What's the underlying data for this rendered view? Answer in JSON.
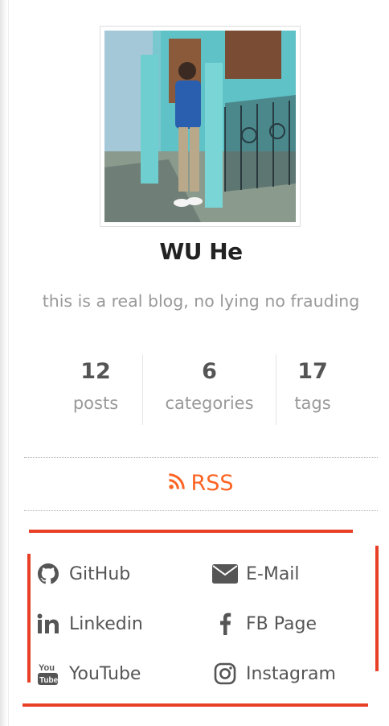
{
  "author": {
    "name": "WU He",
    "description": "this is a real blog, no lying no frauding"
  },
  "stats": [
    {
      "count": "12",
      "label": "posts"
    },
    {
      "count": "6",
      "label": "categories"
    },
    {
      "count": "17",
      "label": "tags"
    }
  ],
  "rss": {
    "label": "RSS",
    "icon": "rss-icon"
  },
  "social_links": [
    {
      "label": "GitHub",
      "icon": "github-icon"
    },
    {
      "label": "E-Mail",
      "icon": "envelope-icon"
    },
    {
      "label": "Linkedin",
      "icon": "linkedin-icon"
    },
    {
      "label": "FB Page",
      "icon": "facebook-icon"
    },
    {
      "label": "YouTube",
      "icon": "youtube-icon"
    },
    {
      "label": "Instagram",
      "icon": "instagram-icon"
    }
  ],
  "colors": {
    "accent_orange": "#fc6423",
    "annotation_red": "#e84026",
    "text_dark": "#222222",
    "text_muted": "#999999",
    "link_gray": "#555555"
  }
}
